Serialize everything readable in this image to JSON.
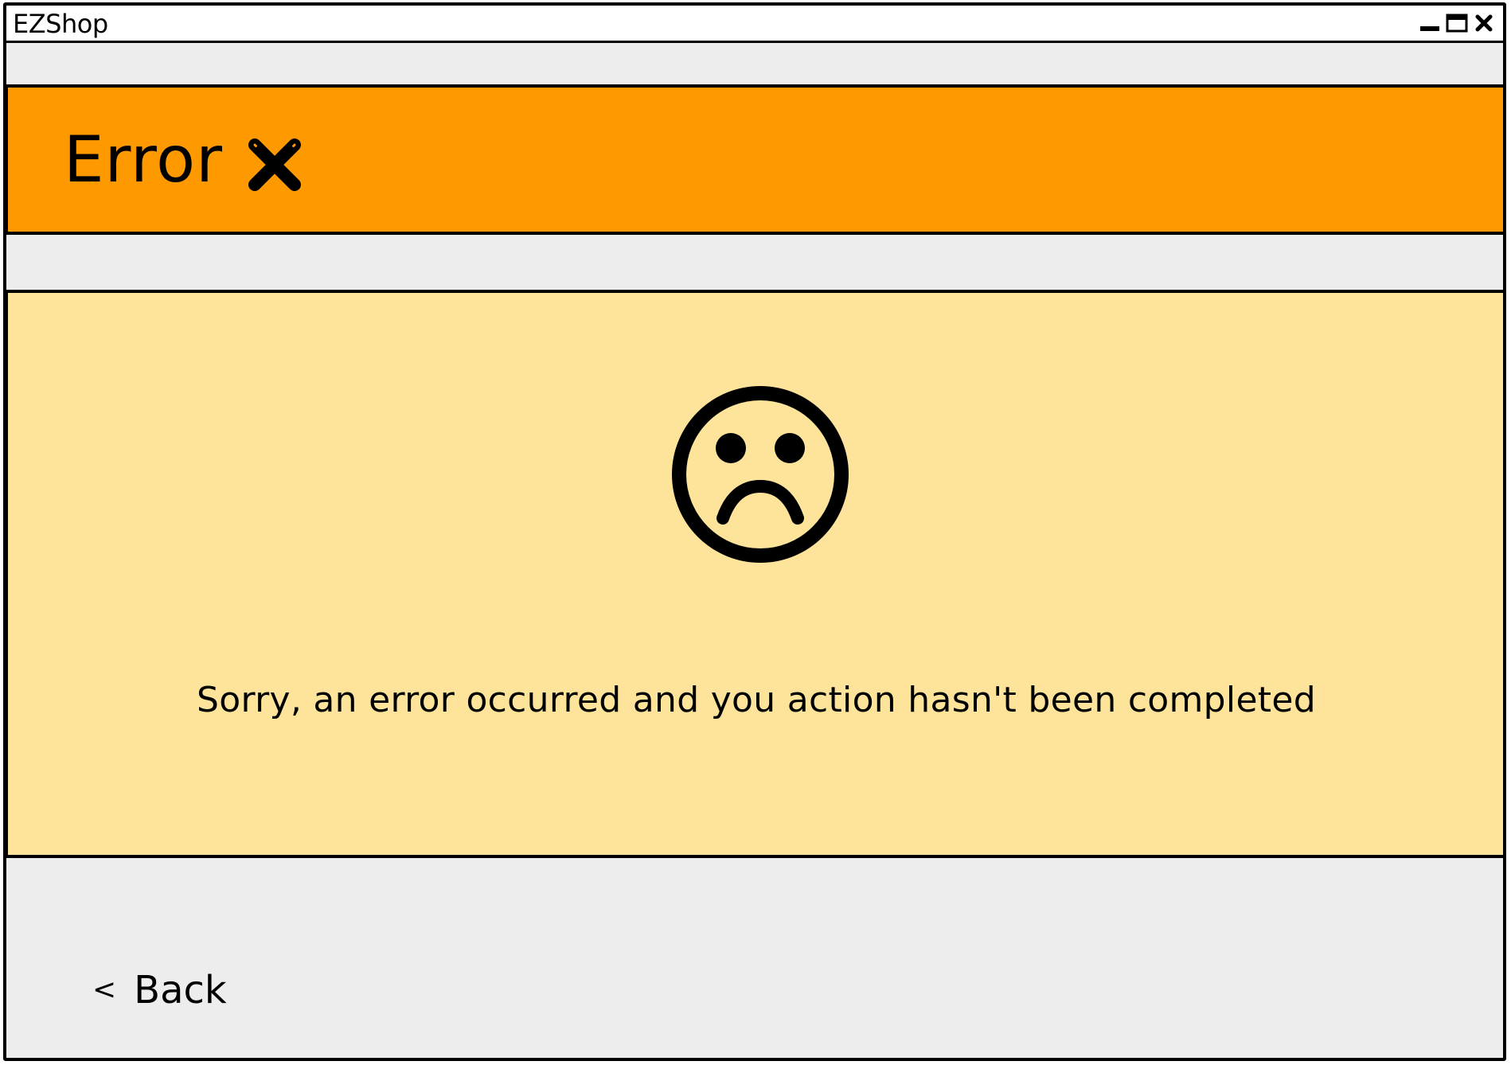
{
  "window": {
    "title": "EZShop",
    "controls": {
      "minimize_icon": "minimize-icon",
      "maximize_icon": "maximize-icon",
      "close_icon": "close-icon"
    }
  },
  "header": {
    "title": "Error",
    "icon": "error-x-icon",
    "background_color": "#ff9900"
  },
  "message_panel": {
    "icon": "sad-face-icon",
    "text": "Sorry, an error occurred and you action hasn't been completed",
    "background_color": "#fde49a"
  },
  "footer": {
    "back_chevron": "<",
    "back_label": "Back"
  }
}
